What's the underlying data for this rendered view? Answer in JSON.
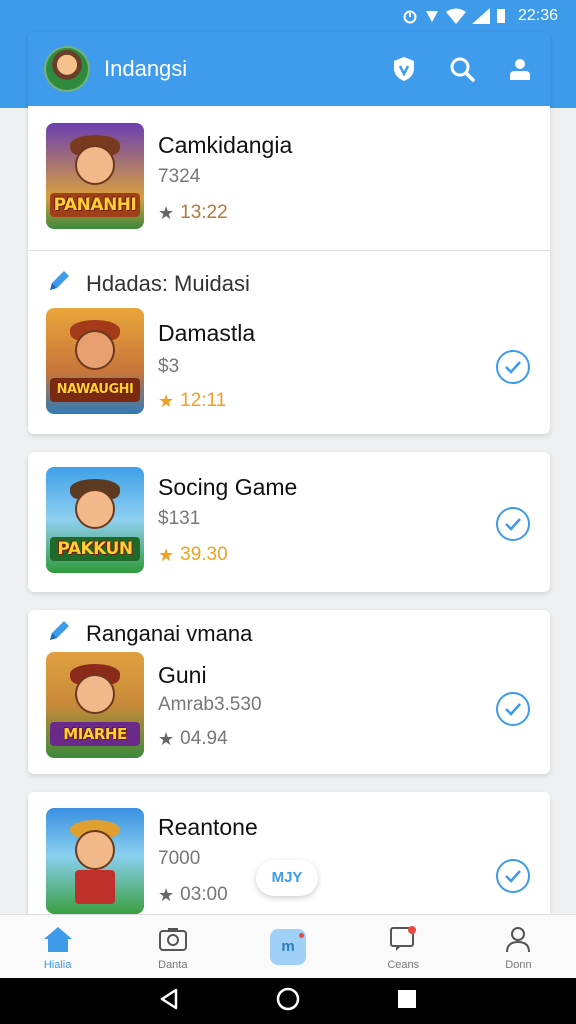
{
  "status_bar": {
    "time": "22:36"
  },
  "header": {
    "title": "Indangsi",
    "avatar": "avatar-image",
    "icons": [
      "shield-icon",
      "search-icon",
      "profile-icon"
    ]
  },
  "top_card": {
    "title": "Camkidangia",
    "subtitle": "7324",
    "rating": "13:22",
    "badge": "PANANHI"
  },
  "section1": {
    "label": "Hdadas: Muidasi"
  },
  "section2": {
    "label": "Ranganai vmana"
  },
  "games": [
    {
      "title": "Damastla",
      "subtitle": "$3",
      "rating": "12:11",
      "badge": "NAWAUGHI",
      "star_color": "#f0a020",
      "rating_color": "#f0a020"
    },
    {
      "title": "Socing Game",
      "subtitle": "$131",
      "rating": "39.30",
      "badge": "PAKKUN",
      "star_color": "#f0a020",
      "rating_color": "#f0a020"
    },
    {
      "title": "Guni",
      "subtitle": "Amrab3.530",
      "rating": "04.94",
      "badge": "MIARHE",
      "star_color": "#666666",
      "rating_color": "#777777"
    },
    {
      "title": "Reantone",
      "subtitle": "7000",
      "rating": "03:00",
      "badge": "",
      "star_color": "#666666",
      "rating_color": "#777777"
    }
  ],
  "floating_pill": {
    "label": "MJY"
  },
  "bottom_nav": [
    {
      "label": "Hialia",
      "icon": "home-icon",
      "active": true
    },
    {
      "label": "Danta",
      "icon": "camera-icon",
      "active": false
    },
    {
      "label": "m",
      "icon": "center-icon",
      "active": false
    },
    {
      "label": "Ceans",
      "icon": "chat-icon",
      "active": false
    },
    {
      "label": "Donn",
      "icon": "person-icon",
      "active": false
    }
  ],
  "colors": {
    "accent": "#3d9bea",
    "star_gold": "#f0a020"
  }
}
